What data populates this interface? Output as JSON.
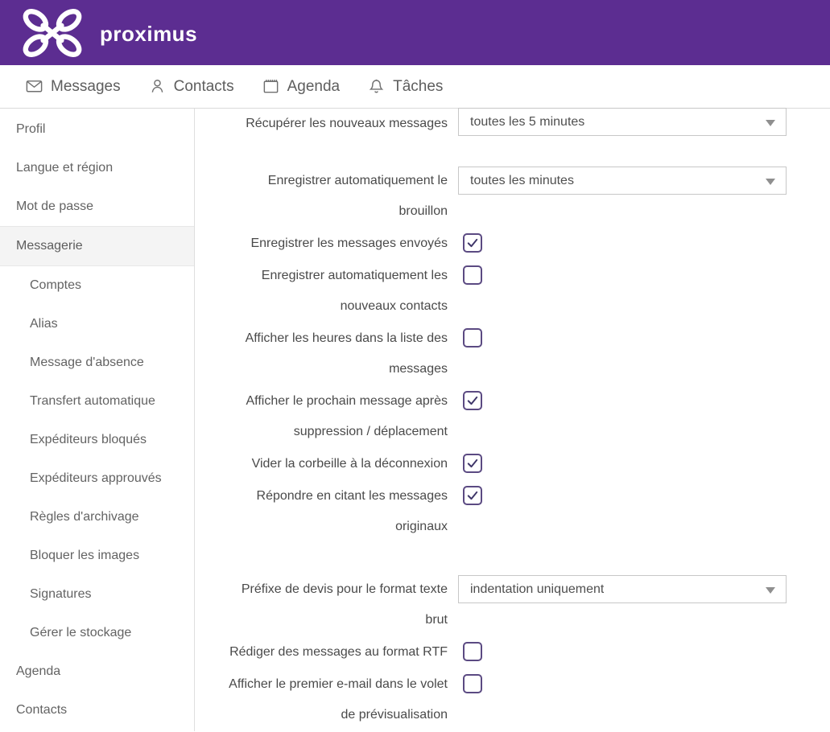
{
  "header": {
    "brand": "proximus"
  },
  "nav": {
    "items": [
      {
        "label": "Messages",
        "icon": "envelope-icon"
      },
      {
        "label": "Contacts",
        "icon": "person-icon"
      },
      {
        "label": "Agenda",
        "icon": "calendar-icon"
      },
      {
        "label": "Tâches",
        "icon": "bell-icon"
      }
    ]
  },
  "sidebar": {
    "items": [
      {
        "label": "Profil",
        "level": 1,
        "selected": false
      },
      {
        "label": "Langue et région",
        "level": 1,
        "selected": false
      },
      {
        "label": "Mot de passe",
        "level": 1,
        "selected": false
      },
      {
        "label": "Messagerie",
        "level": 1,
        "selected": true
      },
      {
        "label": "Comptes",
        "level": 2,
        "selected": false
      },
      {
        "label": "Alias",
        "level": 2,
        "selected": false
      },
      {
        "label": "Message d'absence",
        "level": 2,
        "selected": false
      },
      {
        "label": "Transfert automatique",
        "level": 2,
        "selected": false
      },
      {
        "label": "Expéditeurs bloqués",
        "level": 2,
        "selected": false
      },
      {
        "label": "Expéditeurs approuvés",
        "level": 2,
        "selected": false
      },
      {
        "label": "Règles d'archivage",
        "level": 2,
        "selected": false
      },
      {
        "label": "Bloquer les images",
        "level": 2,
        "selected": false
      },
      {
        "label": "Signatures",
        "level": 2,
        "selected": false
      },
      {
        "label": "Gérer le stockage",
        "level": 2,
        "selected": false
      },
      {
        "label": "Agenda",
        "level": 1,
        "selected": false
      },
      {
        "label": "Contacts",
        "level": 1,
        "selected": false
      }
    ]
  },
  "settings": {
    "rows": [
      {
        "name": "recuperer-nouveaux-messages",
        "type": "select",
        "label_lines": [
          "Récupérer les nouveaux messages"
        ],
        "value": "toutes les 5 minutes"
      },
      {
        "name": "enregistrer-brouillon",
        "type": "select",
        "label_lines": [
          "Enregistrer automatiquement le",
          "brouillon"
        ],
        "value": "toutes les minutes"
      },
      {
        "name": "enregistrer-messages-envoyes",
        "type": "checkbox",
        "label_lines": [
          "Enregistrer les messages envoyés"
        ],
        "checked": true
      },
      {
        "name": "enregistrer-nouveaux-contacts",
        "type": "checkbox",
        "label_lines": [
          "Enregistrer automatiquement les",
          "nouveaux contacts"
        ],
        "checked": false
      },
      {
        "name": "afficher-heures-liste",
        "type": "checkbox",
        "label_lines": [
          "Afficher les heures dans la liste des",
          "messages"
        ],
        "checked": false
      },
      {
        "name": "afficher-prochain-message",
        "type": "checkbox",
        "label_lines": [
          "Afficher le prochain message après",
          "suppression / déplacement"
        ],
        "checked": true
      },
      {
        "name": "vider-corbeille",
        "type": "checkbox",
        "label_lines": [
          "Vider la corbeille à la déconnexion"
        ],
        "checked": true
      },
      {
        "name": "repondre-en-citant",
        "type": "checkbox",
        "label_lines": [
          "Répondre en citant les messages",
          "originaux"
        ],
        "checked": true
      },
      {
        "name": "prefixe-devis",
        "type": "select",
        "label_lines": [
          "Préfixe de devis pour le format texte",
          "brut"
        ],
        "value": "indentation uniquement"
      },
      {
        "name": "rediger-format-rtf",
        "type": "checkbox",
        "label_lines": [
          "Rédiger des messages au format RTF"
        ],
        "checked": false
      },
      {
        "name": "afficher-premier-email",
        "type": "checkbox",
        "label_lines": [
          "Afficher le premier e-mail dans le volet",
          "de prévisualisation"
        ],
        "checked": false
      }
    ]
  },
  "colors": {
    "brand_purple": "#5c2d91",
    "checkbox_purple": "#5b4a82",
    "checkmark_purple": "#3f3669"
  }
}
